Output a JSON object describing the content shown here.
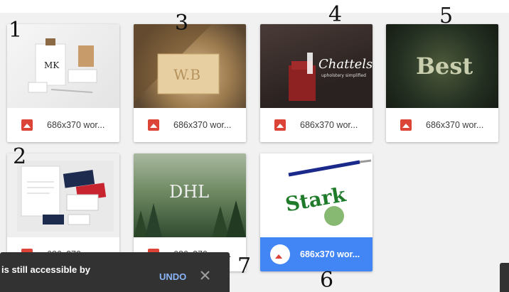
{
  "files": [
    {
      "name": "686x370 wor...",
      "selected": false
    },
    {
      "name": "686x370 wor...",
      "selected": false
    },
    {
      "name": "686x370 wor...",
      "selected": false
    },
    {
      "name": "686x370 wor...",
      "selected": false
    },
    {
      "name": "686x370 wor...",
      "selected": false
    },
    {
      "name": "686x370 wor...",
      "selected": false
    },
    {
      "name": "686x370 wor...",
      "selected": true
    }
  ],
  "thumb_text": {
    "t1_logo": "MK",
    "t2_logo": "W.B",
    "t3_logo": "Chattels",
    "t3_sub": "upholstery simplified",
    "t4_logo": "Best",
    "t6_logo": "DHL",
    "t7_logo": "Stark"
  },
  "annotations": {
    "a1": "1",
    "a2": "2",
    "a3": "3",
    "a4": "4",
    "a5": "5",
    "a6": "6",
    "a7": "7"
  },
  "toast": {
    "message": "is still accessible by",
    "undo_label": "UNDO"
  },
  "colors": {
    "file_icon": "#db4437",
    "selected_footer": "#4285f4",
    "toast_bg": "#323232",
    "undo_text": "#8ab4f8"
  }
}
